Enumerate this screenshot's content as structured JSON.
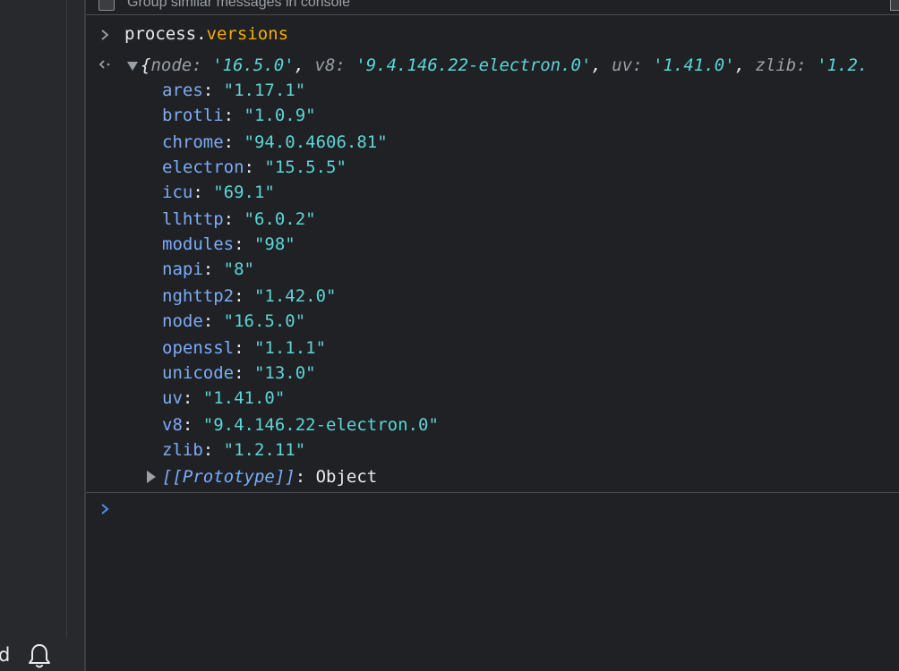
{
  "sidebar": {
    "footer_text": "d"
  },
  "console": {
    "settings_label": "Group similar messages in console",
    "input_command": {
      "object": "process",
      "dot": ".",
      "property": "versions"
    },
    "summary": {
      "open_brace": "{",
      "entries": [
        {
          "key": "node",
          "value": "'16.5.0'"
        },
        {
          "key": "v8",
          "value": "'9.4.146.22-electron.0'"
        },
        {
          "key": "uv",
          "value": "'1.41.0'"
        },
        {
          "key": "zlib",
          "value": "'1.2."
        }
      ]
    },
    "properties": [
      {
        "key": "ares",
        "value": "\"1.17.1\""
      },
      {
        "key": "brotli",
        "value": "\"1.0.9\""
      },
      {
        "key": "chrome",
        "value": "\"94.0.4606.81\""
      },
      {
        "key": "electron",
        "value": "\"15.5.5\""
      },
      {
        "key": "icu",
        "value": "\"69.1\""
      },
      {
        "key": "llhttp",
        "value": "\"6.0.2\""
      },
      {
        "key": "modules",
        "value": "\"98\""
      },
      {
        "key": "napi",
        "value": "\"8\""
      },
      {
        "key": "nghttp2",
        "value": "\"1.42.0\""
      },
      {
        "key": "node",
        "value": "\"16.5.0\""
      },
      {
        "key": "openssl",
        "value": "\"1.1.1\""
      },
      {
        "key": "unicode",
        "value": "\"13.0\""
      },
      {
        "key": "uv",
        "value": "\"1.41.0\""
      },
      {
        "key": "v8",
        "value": "\"9.4.146.22-electron.0\""
      },
      {
        "key": "zlib",
        "value": "\"1.2.11\""
      }
    ],
    "prototype": {
      "key": "[[Prototype]]",
      "value": "Object"
    }
  },
  "colors": {
    "background": "#202124",
    "property_key": "#7cacf8",
    "string_value": "#5cd5d6",
    "prompt_accent": "#4d8ef7",
    "text": "#e8eaed",
    "muted": "#9aa0a6"
  }
}
